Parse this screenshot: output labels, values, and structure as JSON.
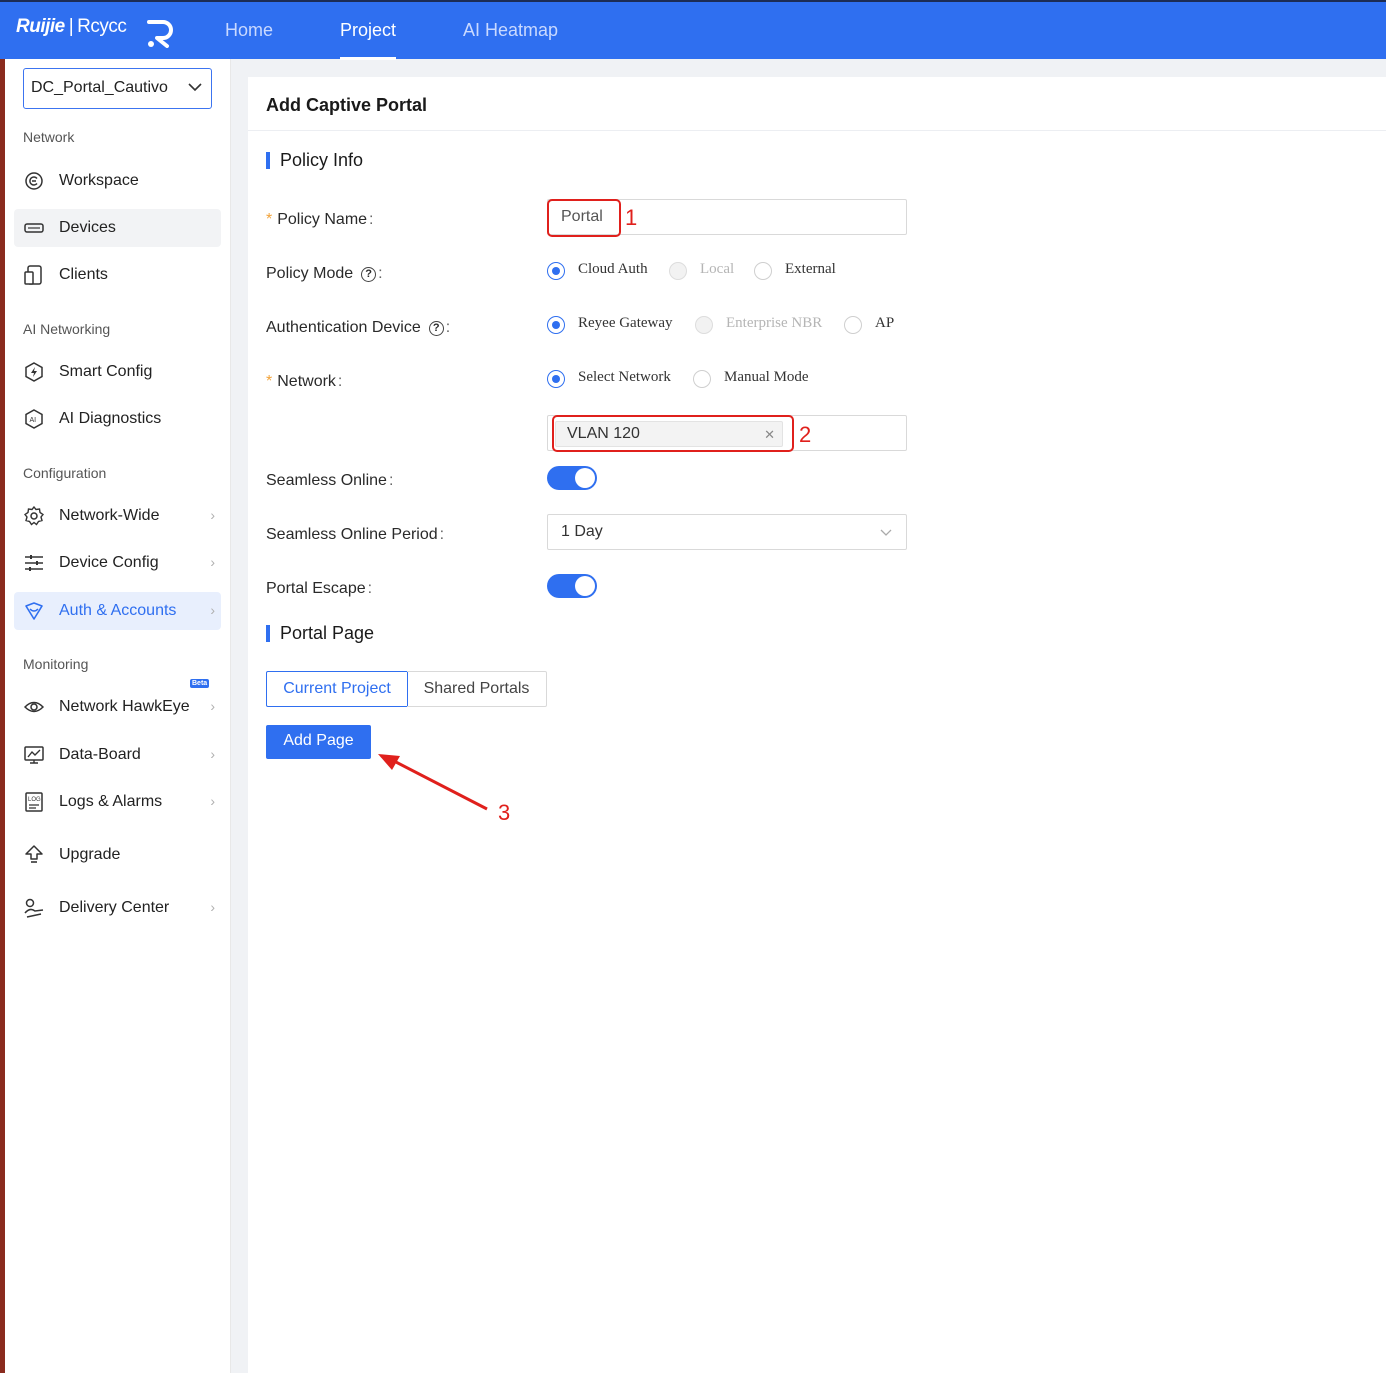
{
  "topbar": {
    "logo_brand": "Ruijie",
    "logo_sep": "|",
    "logo_product": "Rcycc",
    "nav": [
      {
        "label": "Home",
        "active": false
      },
      {
        "label": "Project",
        "active": true
      },
      {
        "label": "AI Heatmap",
        "active": false
      }
    ],
    "accent": "#2f6ff0"
  },
  "sidebar": {
    "project_select": "DC_Portal_Cautivo",
    "sections": {
      "network": "Network",
      "ai_networking": "AI Networking",
      "configuration": "Configuration",
      "monitoring": "Monitoring"
    },
    "items": [
      {
        "label": "Workspace",
        "icon": "workspace-icon"
      },
      {
        "label": "Devices",
        "icon": "devices-icon"
      },
      {
        "label": "Clients",
        "icon": "clients-icon"
      },
      {
        "label": "Smart Config",
        "icon": "smart-config-icon"
      },
      {
        "label": "AI Diagnostics",
        "icon": "ai-diagnostics-icon"
      },
      {
        "label": "Network-Wide",
        "icon": "gear-icon"
      },
      {
        "label": "Device Config",
        "icon": "sliders-icon"
      },
      {
        "label": "Auth & Accounts",
        "icon": "shield-icon"
      },
      {
        "label": "Network HawkEye",
        "icon": "eye-icon",
        "badge": "Beta"
      },
      {
        "label": "Data-Board",
        "icon": "dashboard-icon"
      },
      {
        "label": "Logs & Alarms",
        "icon": "logs-icon"
      },
      {
        "label": "Upgrade",
        "icon": "upgrade-icon"
      },
      {
        "label": "Delivery Center",
        "icon": "delivery-icon"
      }
    ]
  },
  "main": {
    "title": "Add Captive Portal",
    "policy_info": {
      "title": "Policy Info",
      "policy_name_label": "Policy Name",
      "policy_name_value": "Portal",
      "policy_mode_label": "Policy Mode",
      "policy_mode_options": [
        "Cloud Auth",
        "Local",
        "External"
      ],
      "auth_device_label": "Authentication Device",
      "auth_device_options": [
        "Reyee Gateway",
        "Enterprise NBR",
        "AP"
      ],
      "network_label": "Network",
      "network_options": [
        "Select Network",
        "Manual Mode"
      ],
      "network_tag": "VLAN 120",
      "seamless_online_label": "Seamless Online",
      "seamless_online_on": true,
      "seamless_period_label": "Seamless Online Period",
      "seamless_period_value": "1 Day",
      "portal_escape_label": "Portal Escape",
      "portal_escape_on": true
    },
    "portal_page": {
      "title": "Portal Page",
      "tabs": [
        "Current Project",
        "Shared Portals"
      ],
      "add_button": "Add Page"
    }
  },
  "annotations": [
    "1",
    "2",
    "3"
  ],
  "annotation_color": "#e0201c"
}
